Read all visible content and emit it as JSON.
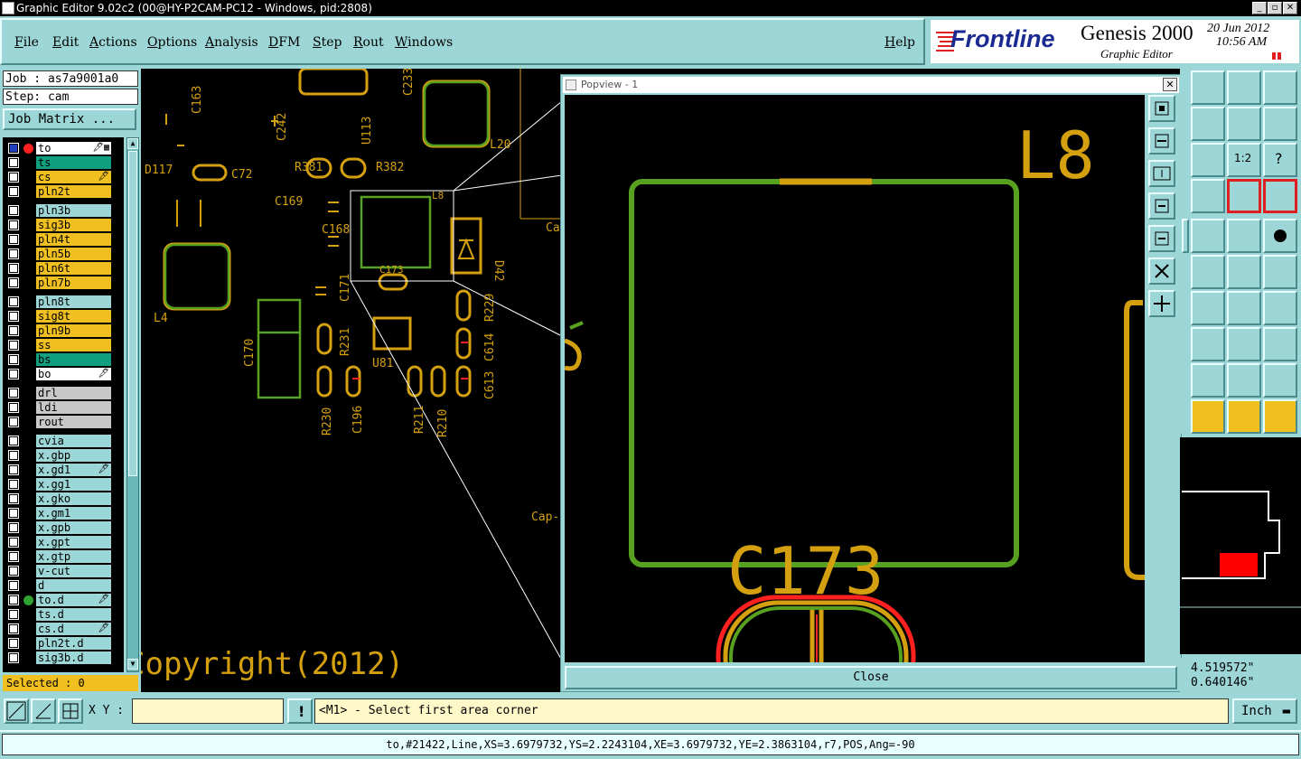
{
  "window": {
    "title": "Graphic Editor 9.02c2 (00@HY-P2CAM-PC12 - Windows, pid:2808)"
  },
  "menu": {
    "items": [
      "File",
      "Edit",
      "Actions",
      "Options",
      "Analysis",
      "DFM",
      "Step",
      "Rout",
      "Windows"
    ],
    "help": "Help"
  },
  "brand": {
    "logo": "Frontline",
    "product": "Genesis 2000",
    "subtitle": "Graphic Editor",
    "date": "20 Jun 2012",
    "time": "10:56 AM"
  },
  "job": {
    "job_label": "Job : as7a9001a0",
    "step_label": "Step: cam",
    "matrix_button": "Job Matrix ..."
  },
  "layers": [
    {
      "name": "to",
      "color": "#ffffff",
      "dot": "#ff2020",
      "mark": "🖋▦"
    },
    {
      "name": "ts",
      "color": "#10a080",
      "dot": "",
      "mark": ""
    },
    {
      "name": "cs",
      "color": "#f0c020",
      "dot": "",
      "mark": "🖋"
    },
    {
      "name": "pln2t",
      "color": "#f0c020",
      "dot": "",
      "mark": ""
    },
    {
      "name": "pln3b",
      "color": "#9cd6d6",
      "dot": "",
      "mark": ""
    },
    {
      "name": "sig3b",
      "color": "#f0c020",
      "dot": "",
      "mark": ""
    },
    {
      "name": "pln4t",
      "color": "#f0c020",
      "dot": "",
      "mark": ""
    },
    {
      "name": "pln5b",
      "color": "#f0c020",
      "dot": "",
      "mark": ""
    },
    {
      "name": "pln6t",
      "color": "#f0c020",
      "dot": "",
      "mark": ""
    },
    {
      "name": "pln7b",
      "color": "#f0c020",
      "dot": "",
      "mark": ""
    },
    {
      "name": "pln8t",
      "color": "#9cd6d6",
      "dot": "",
      "mark": ""
    },
    {
      "name": "sig8t",
      "color": "#f0c020",
      "dot": "",
      "mark": ""
    },
    {
      "name": "pln9b",
      "color": "#f0c020",
      "dot": "",
      "mark": ""
    },
    {
      "name": "ss",
      "color": "#f0c020",
      "dot": "",
      "mark": ""
    },
    {
      "name": "bs",
      "color": "#10a080",
      "dot": "",
      "mark": ""
    },
    {
      "name": "bo",
      "color": "#ffffff",
      "dot": "",
      "mark": "🖋"
    },
    {
      "name": "drl",
      "color": "#c8c8c8",
      "dot": "",
      "mark": ""
    },
    {
      "name": "ldi",
      "color": "#c8c8c8",
      "dot": "",
      "mark": ""
    },
    {
      "name": "rout",
      "color": "#c8c8c8",
      "dot": "",
      "mark": ""
    },
    {
      "name": "cvia",
      "color": "#9cd6d6",
      "dot": "",
      "mark": ""
    },
    {
      "name": "x.gbp",
      "color": "#9cd6d6",
      "dot": "",
      "mark": ""
    },
    {
      "name": "x.gd1",
      "color": "#9cd6d6",
      "dot": "",
      "mark": "🖋"
    },
    {
      "name": "x.gg1",
      "color": "#9cd6d6",
      "dot": "",
      "mark": ""
    },
    {
      "name": "x.gko",
      "color": "#9cd6d6",
      "dot": "",
      "mark": ""
    },
    {
      "name": "x.gm1",
      "color": "#9cd6d6",
      "dot": "",
      "mark": ""
    },
    {
      "name": "x.gpb",
      "color": "#9cd6d6",
      "dot": "",
      "mark": ""
    },
    {
      "name": "x.gpt",
      "color": "#9cd6d6",
      "dot": "",
      "mark": ""
    },
    {
      "name": "x.gtp",
      "color": "#9cd6d6",
      "dot": "",
      "mark": ""
    },
    {
      "name": "v-cut",
      "color": "#9cd6d6",
      "dot": "",
      "mark": ""
    },
    {
      "name": "d",
      "color": "#9cd6d6",
      "dot": "",
      "mark": ""
    },
    {
      "name": "to.d",
      "color": "#9cd6d6",
      "dot": "#30a030",
      "mark": "🖋"
    },
    {
      "name": "ts.d",
      "color": "#9cd6d6",
      "dot": "",
      "mark": ""
    },
    {
      "name": "cs.d",
      "color": "#9cd6d6",
      "dot": "",
      "mark": "🖋"
    },
    {
      "name": "pln2t.d",
      "color": "#9cd6d6",
      "dot": "",
      "mark": ""
    },
    {
      "name": "sig3b.d",
      "color": "#9cd6d6",
      "dot": "",
      "mark": ""
    }
  ],
  "selected": "Selected : 0",
  "canvas_labels": {
    "r381": "R381",
    "r382": "R382",
    "c242": "C242",
    "u113": "U113",
    "l20": "L20",
    "c169": "C169",
    "c168": "C168",
    "c72": "C72",
    "l8": "L8",
    "c173": "C173",
    "d42": "D42",
    "c171": "C171",
    "r231": "R231",
    "u81": "U81",
    "r229": "R229",
    "c614": "C614",
    "c613": "C613",
    "r211": "R211",
    "r210": "R210",
    "r230": "R230",
    "c196": "C196",
    "c170": "C170",
    "l4": "L4",
    "d117": "D117",
    "c163": "C163",
    "c233": "C233",
    "cap": "Cap-",
    "ca": "Ca",
    "copyright": "Copyright(2012)"
  },
  "popview": {
    "title": "Popview - 1",
    "close": "Close",
    "label_l8": "L8",
    "label_c173": "C173"
  },
  "coords": {
    "x": "4.519572\"",
    "y": "0.640146\""
  },
  "bottom": {
    "xy_label": "X Y :",
    "xy_value": "",
    "prompt": "<M1> - Select first area corner",
    "units": "Inch"
  },
  "status": "to,#21422,Line,XS=3.6979732,YS=2.2243104,XE=3.6979732,YE=2.3863104,r7,POS,Ang=-90",
  "colors": {
    "outline_green": "#58a020",
    "silk_yellow": "#d4a010",
    "highlight_red": "#ff2020"
  }
}
